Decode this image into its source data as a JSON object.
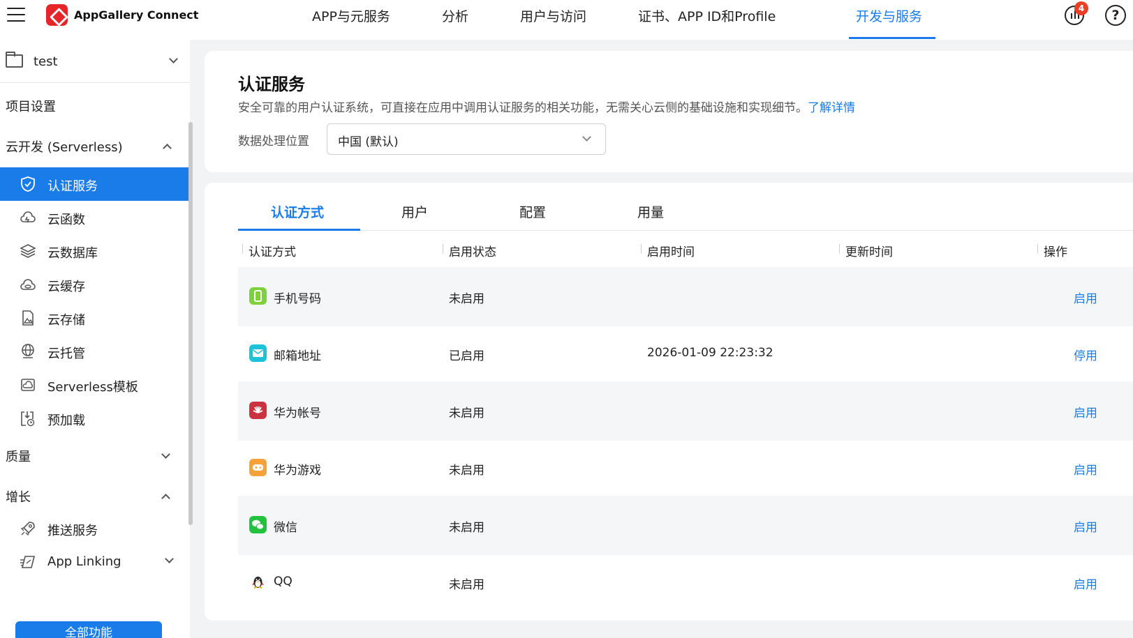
{
  "header": {
    "brand": "AppGallery Connect",
    "nav": [
      {
        "label": "APP与元服务"
      },
      {
        "label": "分析"
      },
      {
        "label": "用户与访问"
      },
      {
        "label": "证书、APP ID和Profile"
      },
      {
        "label": "开发与服务"
      }
    ],
    "notification_count": "4",
    "help_label": "?"
  },
  "sidebar": {
    "project": "test",
    "project_settings": "项目设置",
    "sections": {
      "serverless": "云开发 (Serverless)",
      "quality": "质量",
      "growth": "增长"
    },
    "serverless_items": [
      {
        "label": "认证服务"
      },
      {
        "label": "云函数"
      },
      {
        "label": "云数据库"
      },
      {
        "label": "云缓存"
      },
      {
        "label": "云存储"
      },
      {
        "label": "云托管"
      },
      {
        "label": "Serverless模板"
      },
      {
        "label": "预加载"
      }
    ],
    "growth_items": [
      {
        "label": "推送服务"
      },
      {
        "label": "App Linking"
      }
    ],
    "all_button": "全部功能"
  },
  "page": {
    "title": "认证服务",
    "description": "安全可靠的用户认证系统，可直接在应用中调用认证服务的相关功能，无需关心云侧的基础设施和实现细节。",
    "learn_more": "了解详情",
    "location_label": "数据处理位置",
    "location_value": "中国 (默认)"
  },
  "tabs": [
    {
      "label": "认证方式"
    },
    {
      "label": "用户"
    },
    {
      "label": "配置"
    },
    {
      "label": "用量"
    }
  ],
  "table": {
    "columns": [
      "认证方式",
      "启用状态",
      "启用时间",
      "更新时间",
      "操作"
    ],
    "rows": [
      {
        "method": "手机号码",
        "status": "未启用",
        "enabled_time": "",
        "updated_time": "",
        "action": "启用",
        "icon_color": "#7fd13b"
      },
      {
        "method": "邮箱地址",
        "status": "已启用",
        "enabled_time": "2026-01-09 22:23:32",
        "updated_time": "",
        "action": "停用",
        "icon_color": "#1ec2d8"
      },
      {
        "method": "华为帐号",
        "status": "未启用",
        "enabled_time": "",
        "updated_time": "",
        "action": "启用",
        "icon_color": "#c9323e"
      },
      {
        "method": "华为游戏",
        "status": "未启用",
        "enabled_time": "",
        "updated_time": "",
        "action": "启用",
        "icon_color": "#f7a13a"
      },
      {
        "method": "微信",
        "status": "未启用",
        "enabled_time": "",
        "updated_time": "",
        "action": "启用",
        "icon_color": "#22c13e"
      },
      {
        "method": "QQ",
        "status": "未启用",
        "enabled_time": "",
        "updated_time": "",
        "action": "启用",
        "icon_color": "#222222"
      }
    ]
  },
  "colors": {
    "accent": "#1a7ce8",
    "badge": "#e84026",
    "brand_logo": "#e5252a"
  }
}
